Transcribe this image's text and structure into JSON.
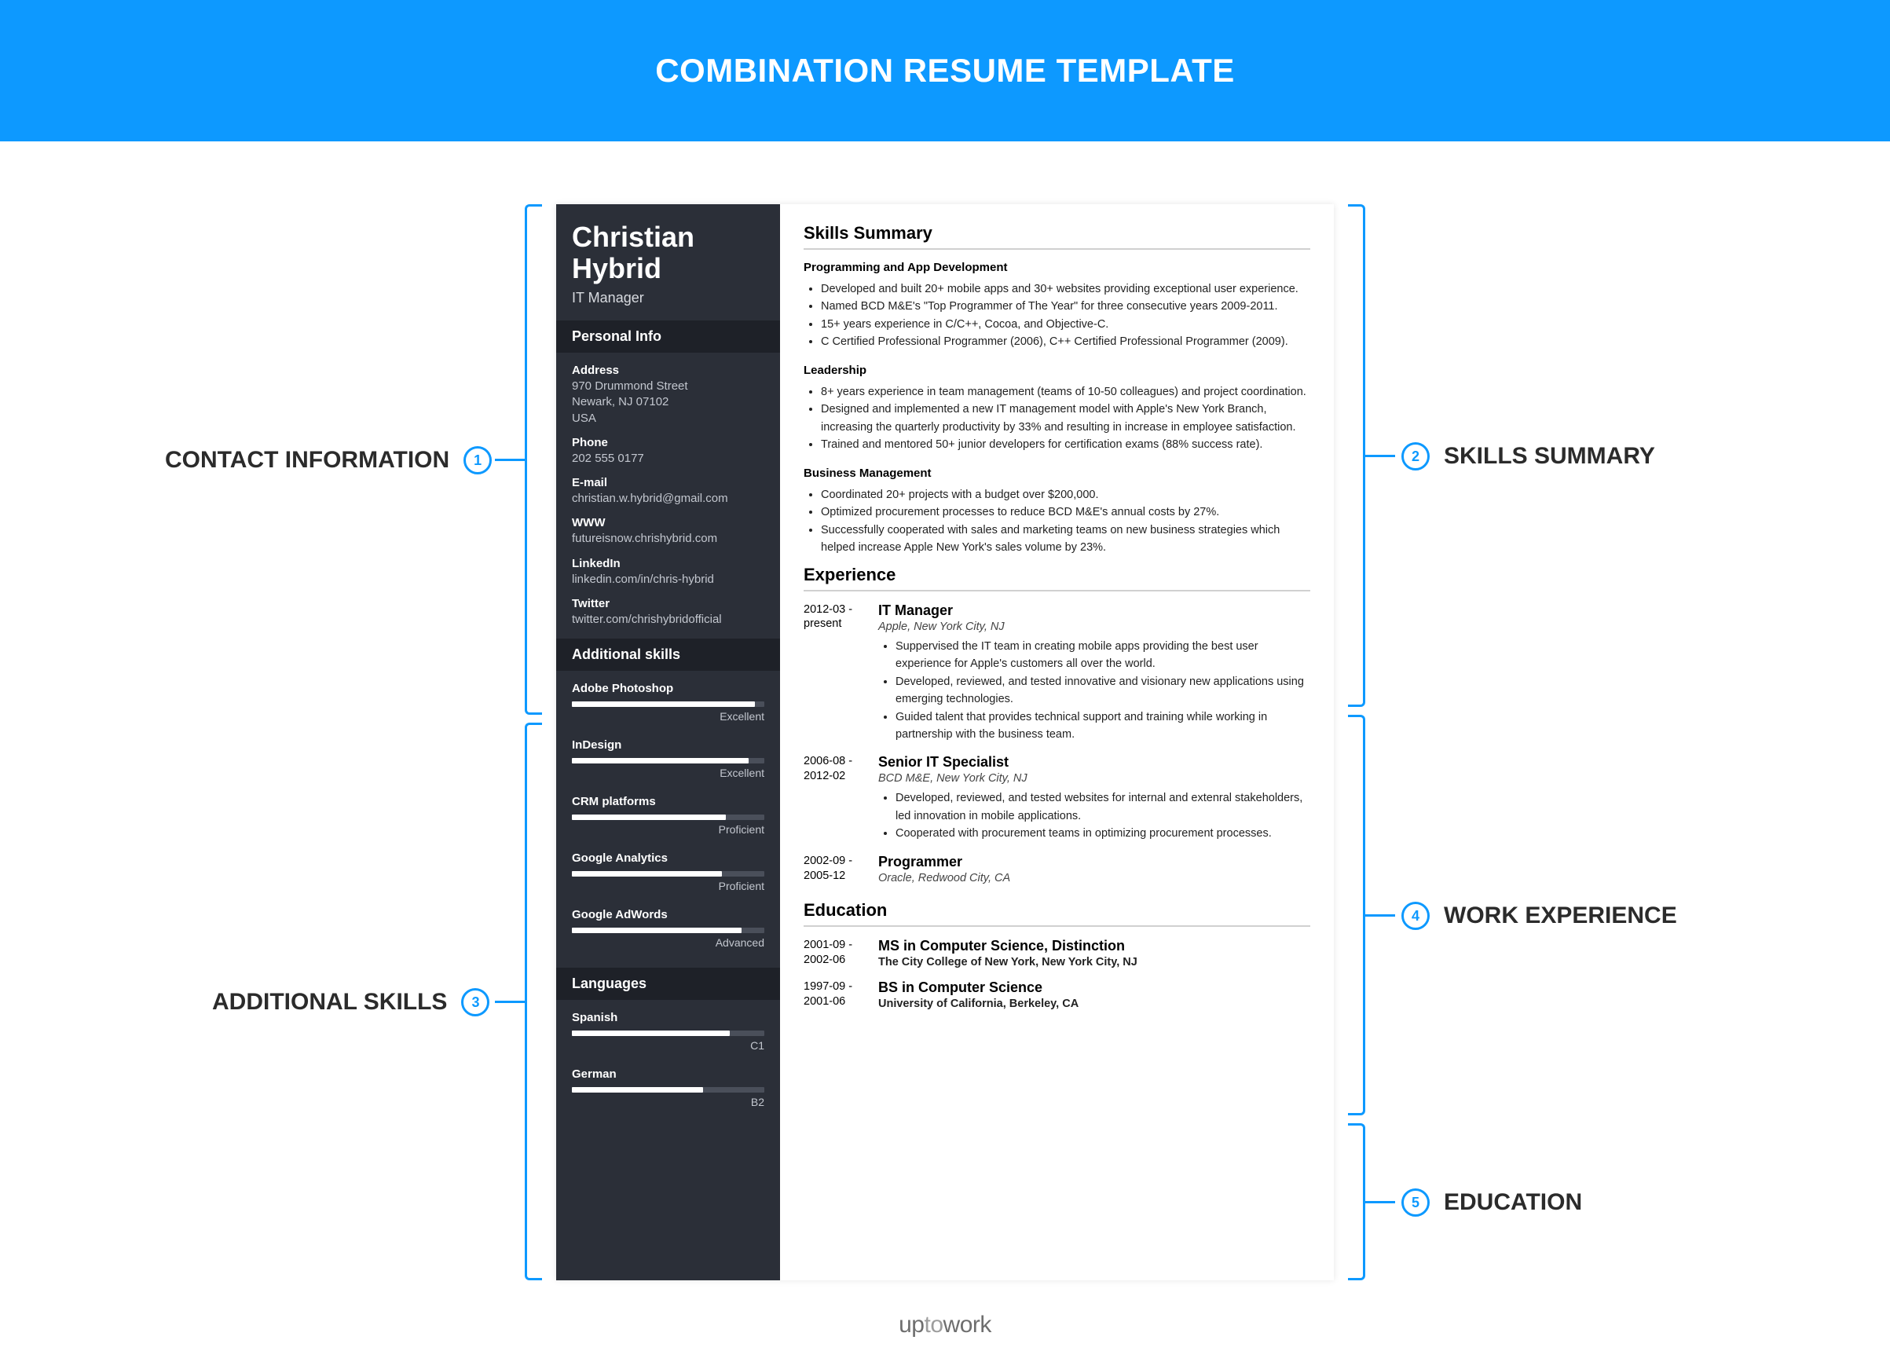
{
  "banner_title": "COMBINATION RESUME TEMPLATE",
  "callouts": {
    "c1": {
      "num": "1",
      "label": "CONTACT INFORMATION"
    },
    "c2": {
      "num": "2",
      "label": "SKILLS SUMMARY"
    },
    "c3": {
      "num": "3",
      "label": "ADDITIONAL SKILLS"
    },
    "c4": {
      "num": "4",
      "label": "WORK EXPERIENCE"
    },
    "c5": {
      "num": "5",
      "label": "EDUCATION"
    }
  },
  "resume": {
    "name_first": "Christian",
    "name_last": "Hybrid",
    "title": "IT Manager",
    "personal_info_header": "Personal Info",
    "personal_info": {
      "address_label": "Address",
      "address_value": "970 Drummond Street\nNewark, NJ 07102\nUSA",
      "phone_label": "Phone",
      "phone_value": "202 555 0177",
      "email_label": "E-mail",
      "email_value": "christian.w.hybrid@gmail.com",
      "www_label": "WWW",
      "www_value": "futureisnow.chrishybrid.com",
      "linkedin_label": "LinkedIn",
      "linkedin_value": "linkedin.com/in/chris-hybrid",
      "twitter_label": "Twitter",
      "twitter_value": "twitter.com/chrishybridofficial"
    },
    "additional_skills_header": "Additional skills",
    "skills": [
      {
        "name": "Adobe Photoshop",
        "level": "Excellent",
        "pct": 95
      },
      {
        "name": "InDesign",
        "level": "Excellent",
        "pct": 92
      },
      {
        "name": "CRM platforms",
        "level": "Proficient",
        "pct": 80
      },
      {
        "name": "Google Analytics",
        "level": "Proficient",
        "pct": 78
      },
      {
        "name": "Google AdWords",
        "level": "Advanced",
        "pct": 88
      }
    ],
    "languages_header": "Languages",
    "languages": [
      {
        "name": "Spanish",
        "level": "C1",
        "pct": 82
      },
      {
        "name": "German",
        "level": "B2",
        "pct": 68
      }
    ],
    "skills_summary_header": "Skills Summary",
    "ss_groups": [
      {
        "title": "Programming and App Development",
        "items": [
          "Developed and built 20+ mobile apps and 30+ websites providing exceptional user experience.",
          "Named BCD M&E's \"Top Programmer of The Year\" for three consecutive years 2009-2011.",
          "15+ years experience in C/C++, Cocoa, and Objective-C.",
          "C Certified Professional Programmer (2006), C++ Certified Professional Programmer (2009)."
        ]
      },
      {
        "title": "Leadership",
        "items": [
          "8+ years experience in team management (teams of 10-50 colleagues) and project coordination.",
          "Designed and implemented a new IT management model with Apple's New York Branch, increasing the quarterly productivity by 33% and resulting in increase in employee satisfaction.",
          "Trained and mentored 50+ junior developers for certification exams (88% success rate)."
        ]
      },
      {
        "title": "Business Management",
        "items": [
          "Coordinated 20+ projects with a budget over $200,000.",
          "Optimized procurement processes to reduce BCD M&E's annual costs by 27%.",
          "Successfully cooperated with sales and marketing teams on new business strategies which helped increase Apple New York's sales volume by 23%."
        ]
      }
    ],
    "experience_header": "Experience",
    "experience": [
      {
        "dates": "2012-03 - present",
        "title": "IT Manager",
        "company": "Apple, New York City, NJ",
        "items": [
          "Suppervised the IT team in creating mobile apps providing the best user experience for Apple's customers all over the world.",
          "Developed, reviewed, and tested innovative and visionary new applications using emerging technologies.",
          "Guided talent that provides technical support and training while working in partnership with the business team."
        ]
      },
      {
        "dates": "2006-08 - 2012-02",
        "title": "Senior IT Specialist",
        "company": "BCD M&E, New York City, NJ",
        "items": [
          "Developed, reviewed, and tested websites for internal and extenral stakeholders, led innovation in mobile applications.",
          "Cooperated with procurement teams in optimizing procurement processes."
        ]
      },
      {
        "dates": "2002-09 - 2005-12",
        "title": "Programmer",
        "company": "Oracle, Redwood City, CA",
        "items": []
      }
    ],
    "education_header": "Education",
    "education": [
      {
        "dates": "2001-09 - 2002-06",
        "degree": "MS in Computer Science, Distinction",
        "school": "The City College of New York, New York City, NJ"
      },
      {
        "dates": "1997-09 - 2001-06",
        "degree": "BS in Computer Science",
        "school": "University of California, Berkeley, CA"
      }
    ]
  },
  "brand": {
    "up": "up",
    "to": "to",
    "work": "work"
  }
}
